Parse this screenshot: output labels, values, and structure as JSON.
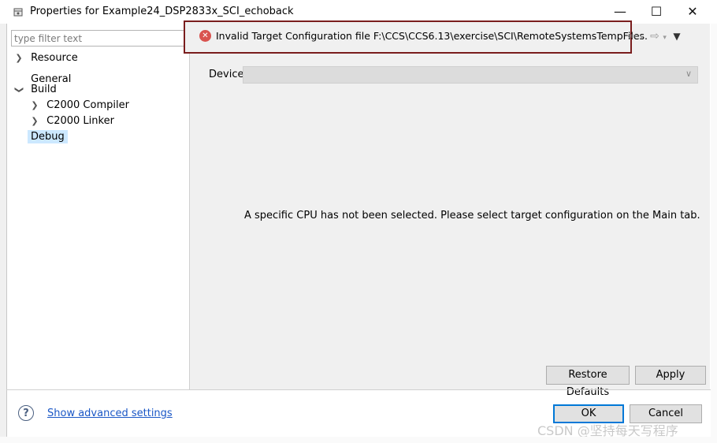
{
  "window": {
    "title": "Properties for Example24_DSP2833x_SCI_echoback",
    "minimize_glyph": "—",
    "maximize_glyph": "☐",
    "close_glyph": "✕"
  },
  "filter": {
    "placeholder": "type filter text",
    "value": ""
  },
  "tree": {
    "resource": "Resource",
    "general": "General",
    "build": "Build",
    "compiler": "C2000 Compiler",
    "linker": "C2000 Linker",
    "debug": "Debug",
    "selected": "Debug"
  },
  "error": {
    "message": "Invalid Target Configuration file F:\\CCS\\CCS6.13\\exercise\\SCI\\RemoteSystemsTempFiles.",
    "icon": "error-circle-x-icon",
    "color": "#d9534f",
    "highlight_color": "#7a1d1d"
  },
  "device": {
    "label": "Device",
    "value": ""
  },
  "main": {
    "message": "A specific CPU has not been selected. Please select target configuration on the Main tab."
  },
  "buttons": {
    "restore": "Restore Defaults",
    "apply": "Apply",
    "ok": "OK",
    "cancel": "Cancel"
  },
  "footer": {
    "advanced_link": "Show advanced settings"
  },
  "watermark": "CSDN @坚持每天写程序",
  "colors": {
    "accent": "#0078d7",
    "link": "#1a57c6",
    "selection": "#cce8ff"
  }
}
